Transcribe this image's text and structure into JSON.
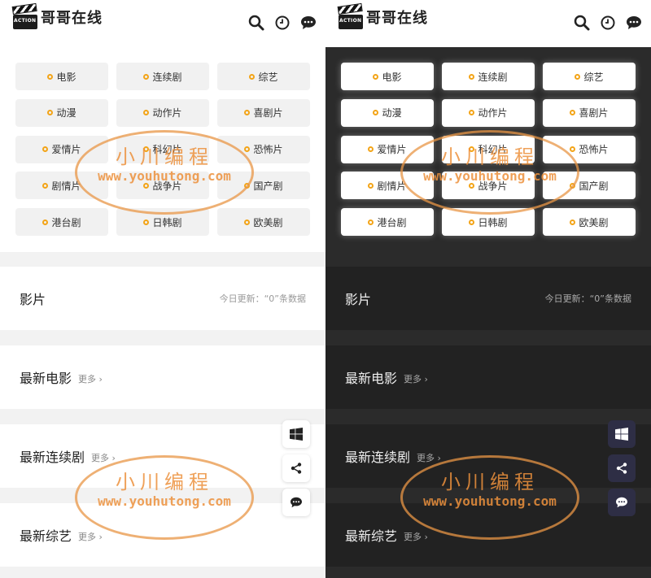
{
  "app": {
    "title": "哥哥在线",
    "logo_text": "ACTION"
  },
  "categories": [
    "电影",
    "连续剧",
    "综艺",
    "动漫",
    "动作片",
    "喜剧片",
    "爱情片",
    "科幻片",
    "恐怖片",
    "剧情片",
    "战争片",
    "国产剧",
    "港台剧",
    "日韩剧",
    "欧美剧"
  ],
  "sections": {
    "films": {
      "title": "影片",
      "update_text": "今日更新：“0”条数据"
    },
    "latest_movie": {
      "title": "最新电影",
      "more": "更多 ›"
    },
    "latest_series": {
      "title": "最新连续剧",
      "more": "更多 ›"
    },
    "latest_variety": {
      "title": "最新综艺",
      "more": "更多 ›"
    }
  },
  "watermark": {
    "line1": "小川编程",
    "line2": "www.youhutong.com"
  },
  "colors": {
    "accent": "#f3a417",
    "dark_bg": "#2b2b2b",
    "dark_card": "#222222"
  }
}
